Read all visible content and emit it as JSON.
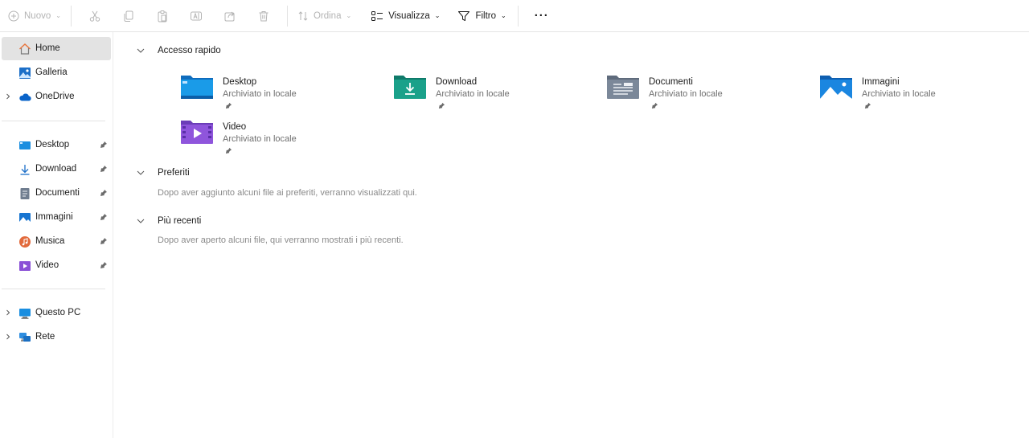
{
  "toolbar": {
    "new_label": "Nuovo",
    "sort_label": "Ordina",
    "view_label": "Visualizza",
    "filter_label": "Filtro",
    "more_label": "···"
  },
  "sidebar": {
    "top": [
      {
        "label": "Home",
        "icon": "home-icon",
        "selected": true
      },
      {
        "label": "Galleria",
        "icon": "gallery-icon"
      },
      {
        "label": "OneDrive",
        "icon": "onedrive-icon",
        "expandable": true
      }
    ],
    "pinned": [
      {
        "label": "Desktop",
        "icon": "desktop-icon",
        "pinned": true
      },
      {
        "label": "Download",
        "icon": "download-icon",
        "pinned": true
      },
      {
        "label": "Documenti",
        "icon": "documents-icon",
        "pinned": true
      },
      {
        "label": "Immagini",
        "icon": "pictures-icon",
        "pinned": true
      },
      {
        "label": "Musica",
        "icon": "music-icon",
        "pinned": true
      },
      {
        "label": "Video",
        "icon": "video-icon",
        "pinned": true
      }
    ],
    "bottom": [
      {
        "label": "Questo PC",
        "icon": "this-pc-icon",
        "expandable": true
      },
      {
        "label": "Rete",
        "icon": "network-icon",
        "expandable": true
      }
    ]
  },
  "main": {
    "quick_access": {
      "title": "Accesso rapido",
      "items": [
        {
          "name": "Desktop",
          "subtitle": "Archiviato in locale",
          "icon": "desktop-folder-icon"
        },
        {
          "name": "Download",
          "subtitle": "Archiviato in locale",
          "icon": "download-folder-icon"
        },
        {
          "name": "Documenti",
          "subtitle": "Archiviato in locale",
          "icon": "documents-folder-icon"
        },
        {
          "name": "Immagini",
          "subtitle": "Archiviato in locale",
          "icon": "pictures-folder-icon"
        },
        {
          "name": "Video",
          "subtitle": "Archiviato in locale",
          "icon": "video-folder-icon"
        }
      ]
    },
    "favorites": {
      "title": "Preferiti",
      "empty_text": "Dopo aver aggiunto alcuni file ai preferiti, verranno visualizzati qui."
    },
    "recent": {
      "title": "Più recenti",
      "empty_text": "Dopo aver aperto alcuni file, qui verranno mostrati i più recenti."
    }
  },
  "colors": {
    "accent": "#0078d4",
    "selected_bg": "#e3e3e3",
    "disabled": "#b4b4b4",
    "home_icon": "#e8743b",
    "download_green": "#1aa18a"
  }
}
